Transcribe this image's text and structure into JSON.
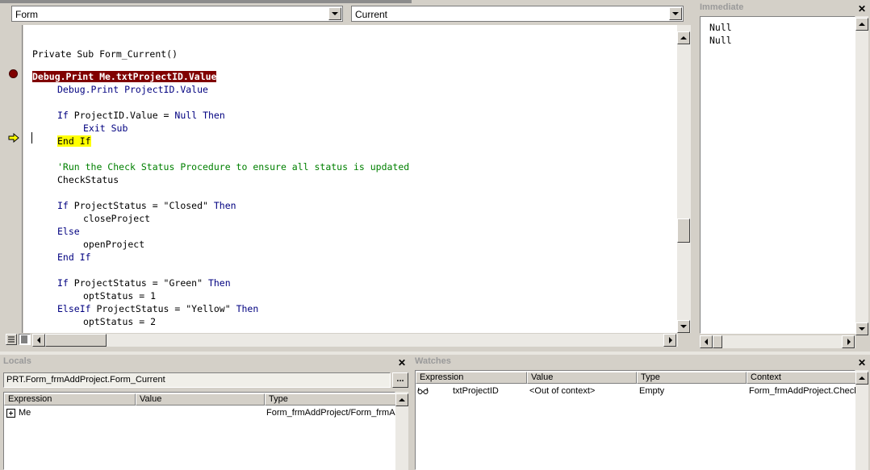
{
  "editor": {
    "object_combo": "Form",
    "procedure_combo": "Current",
    "lines": [
      {
        "segments": [
          {
            "t": "Private Sub Form_Current()",
            "k": "plain"
          }
        ]
      },
      {
        "segments": [
          {
            "t": "Debug.Print Me.txtProjectID.Value",
            "k": "bp"
          }
        ]
      },
      {
        "segments": [
          {
            "t": "Debug.Print ProjectID.Value",
            "k": "kw"
          }
        ]
      },
      {
        "segments": [
          {
            "t": "If",
            "k": "kw"
          },
          {
            "t": " ProjectID.Value = ",
            "k": "plain"
          },
          {
            "t": "Null",
            "k": "kw"
          },
          {
            "t": " ",
            "k": "plain"
          },
          {
            "t": "Then",
            "k": "kw"
          }
        ]
      },
      {
        "segments": [
          {
            "t": "Exit Sub",
            "k": "kw"
          }
        ]
      },
      {
        "segments": [
          {
            "t": "End If",
            "k": "ex"
          }
        ]
      },
      {
        "segments": [
          {
            "t": "'Run the Check Status Procedure to ensure all status is updated",
            "k": "cm"
          }
        ]
      },
      {
        "segments": [
          {
            "t": "CheckStatus",
            "k": "plain"
          }
        ]
      },
      {
        "segments": [
          {
            "t": "If",
            "k": "kw"
          },
          {
            "t": " ProjectStatus = \"Closed\" ",
            "k": "plain"
          },
          {
            "t": "Then",
            "k": "kw"
          }
        ]
      },
      {
        "segments": [
          {
            "t": "closeProject",
            "k": "plain"
          }
        ]
      },
      {
        "segments": [
          {
            "t": "Else",
            "k": "kw"
          }
        ]
      },
      {
        "segments": [
          {
            "t": "openProject",
            "k": "plain"
          }
        ]
      },
      {
        "segments": [
          {
            "t": "End If",
            "k": "kw"
          }
        ]
      },
      {
        "segments": [
          {
            "t": "If",
            "k": "kw"
          },
          {
            "t": " ProjectStatus = \"Green\" ",
            "k": "plain"
          },
          {
            "t": "Then",
            "k": "kw"
          }
        ]
      },
      {
        "segments": [
          {
            "t": "optStatus = 1",
            "k": "plain"
          }
        ]
      },
      {
        "segments": [
          {
            "t": "ElseIf",
            "k": "kw"
          },
          {
            "t": " ProjectStatus = \"Yellow\" ",
            "k": "plain"
          },
          {
            "t": "Then",
            "k": "kw"
          }
        ]
      },
      {
        "segments": [
          {
            "t": "optStatus = 2",
            "k": "plain"
          }
        ]
      }
    ]
  },
  "immediate": {
    "title": "Immediate",
    "lines": [
      "Null",
      "Null"
    ]
  },
  "locals": {
    "title": "Locals",
    "context": "PRT.Form_frmAddProject.Form_Current",
    "context_button": "...",
    "columns": [
      "Expression",
      "Value",
      "Type"
    ],
    "rows": [
      {
        "expand": "+",
        "expression": "Me",
        "value": "",
        "type": "Form_frmAddProject/Form_frmAddProject"
      }
    ]
  },
  "watches": {
    "title": "Watches",
    "columns": [
      "Expression",
      "Value",
      "Type",
      "Context"
    ],
    "rows": [
      {
        "icon": "watch-glasses-icon",
        "expression": "txtProjectID",
        "value": "<Out of context>",
        "type": "Empty",
        "context": "Form_frmAddProject.CheckStatus"
      }
    ]
  },
  "colors": {
    "keyword": "#000080",
    "comment": "#008000",
    "breakpoint": "#800000",
    "execution": "#ffff00"
  }
}
